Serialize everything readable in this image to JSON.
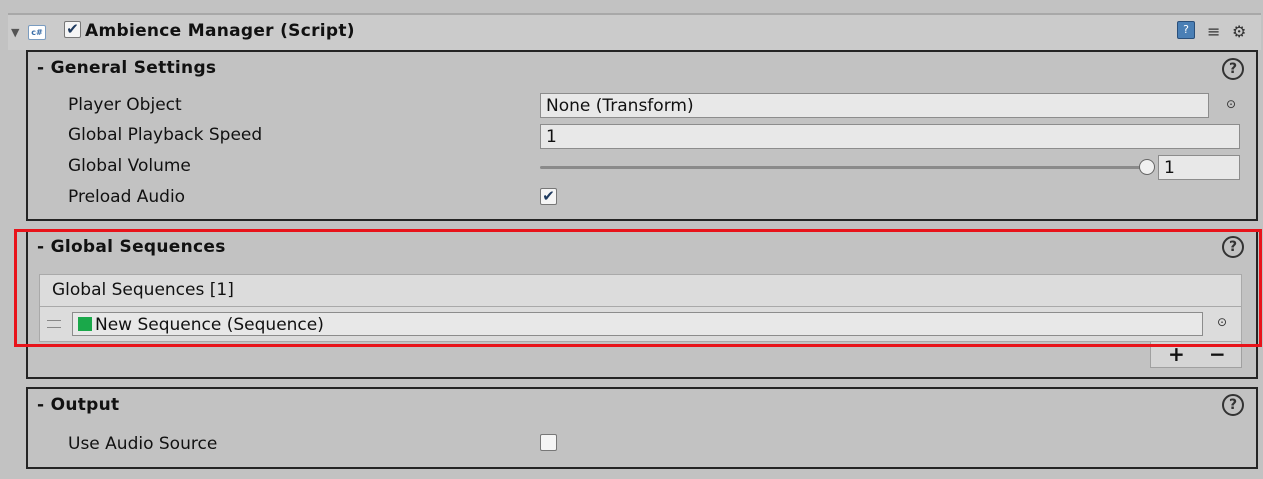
{
  "component": {
    "title": "Ambience Manager (Script)",
    "enabled": true,
    "icons": [
      "foldout-arrow-icon",
      "csharp-script-icon",
      "help-book-icon",
      "preset-icon",
      "gear-icon"
    ]
  },
  "general": {
    "header": "- General Settings",
    "player_object_label": "Player Object",
    "player_object_value": "None (Transform)",
    "playback_speed_label": "Global Playback Speed",
    "playback_speed_value": "1",
    "volume_label": "Global Volume",
    "volume_value": "1",
    "preload_label": "Preload Audio",
    "preload_checked": true
  },
  "sequences": {
    "header": "- Global Sequences",
    "list_header": "Global Sequences [1]",
    "items": [
      {
        "label": "New Sequence (Sequence)"
      }
    ],
    "add_label": "+",
    "remove_label": "−"
  },
  "output": {
    "header": "- Output",
    "use_audio_source_label": "Use Audio Source",
    "use_audio_source_checked": false
  },
  "glyphs": {
    "help": "?",
    "check": "✔",
    "target": "⊙",
    "arrow": "▼",
    "csharp": "c#",
    "book": "?",
    "preset": "≡",
    "gear": "⚙"
  },
  "colors": {
    "highlight": "#e8131a",
    "background": "#c2c2c2"
  }
}
